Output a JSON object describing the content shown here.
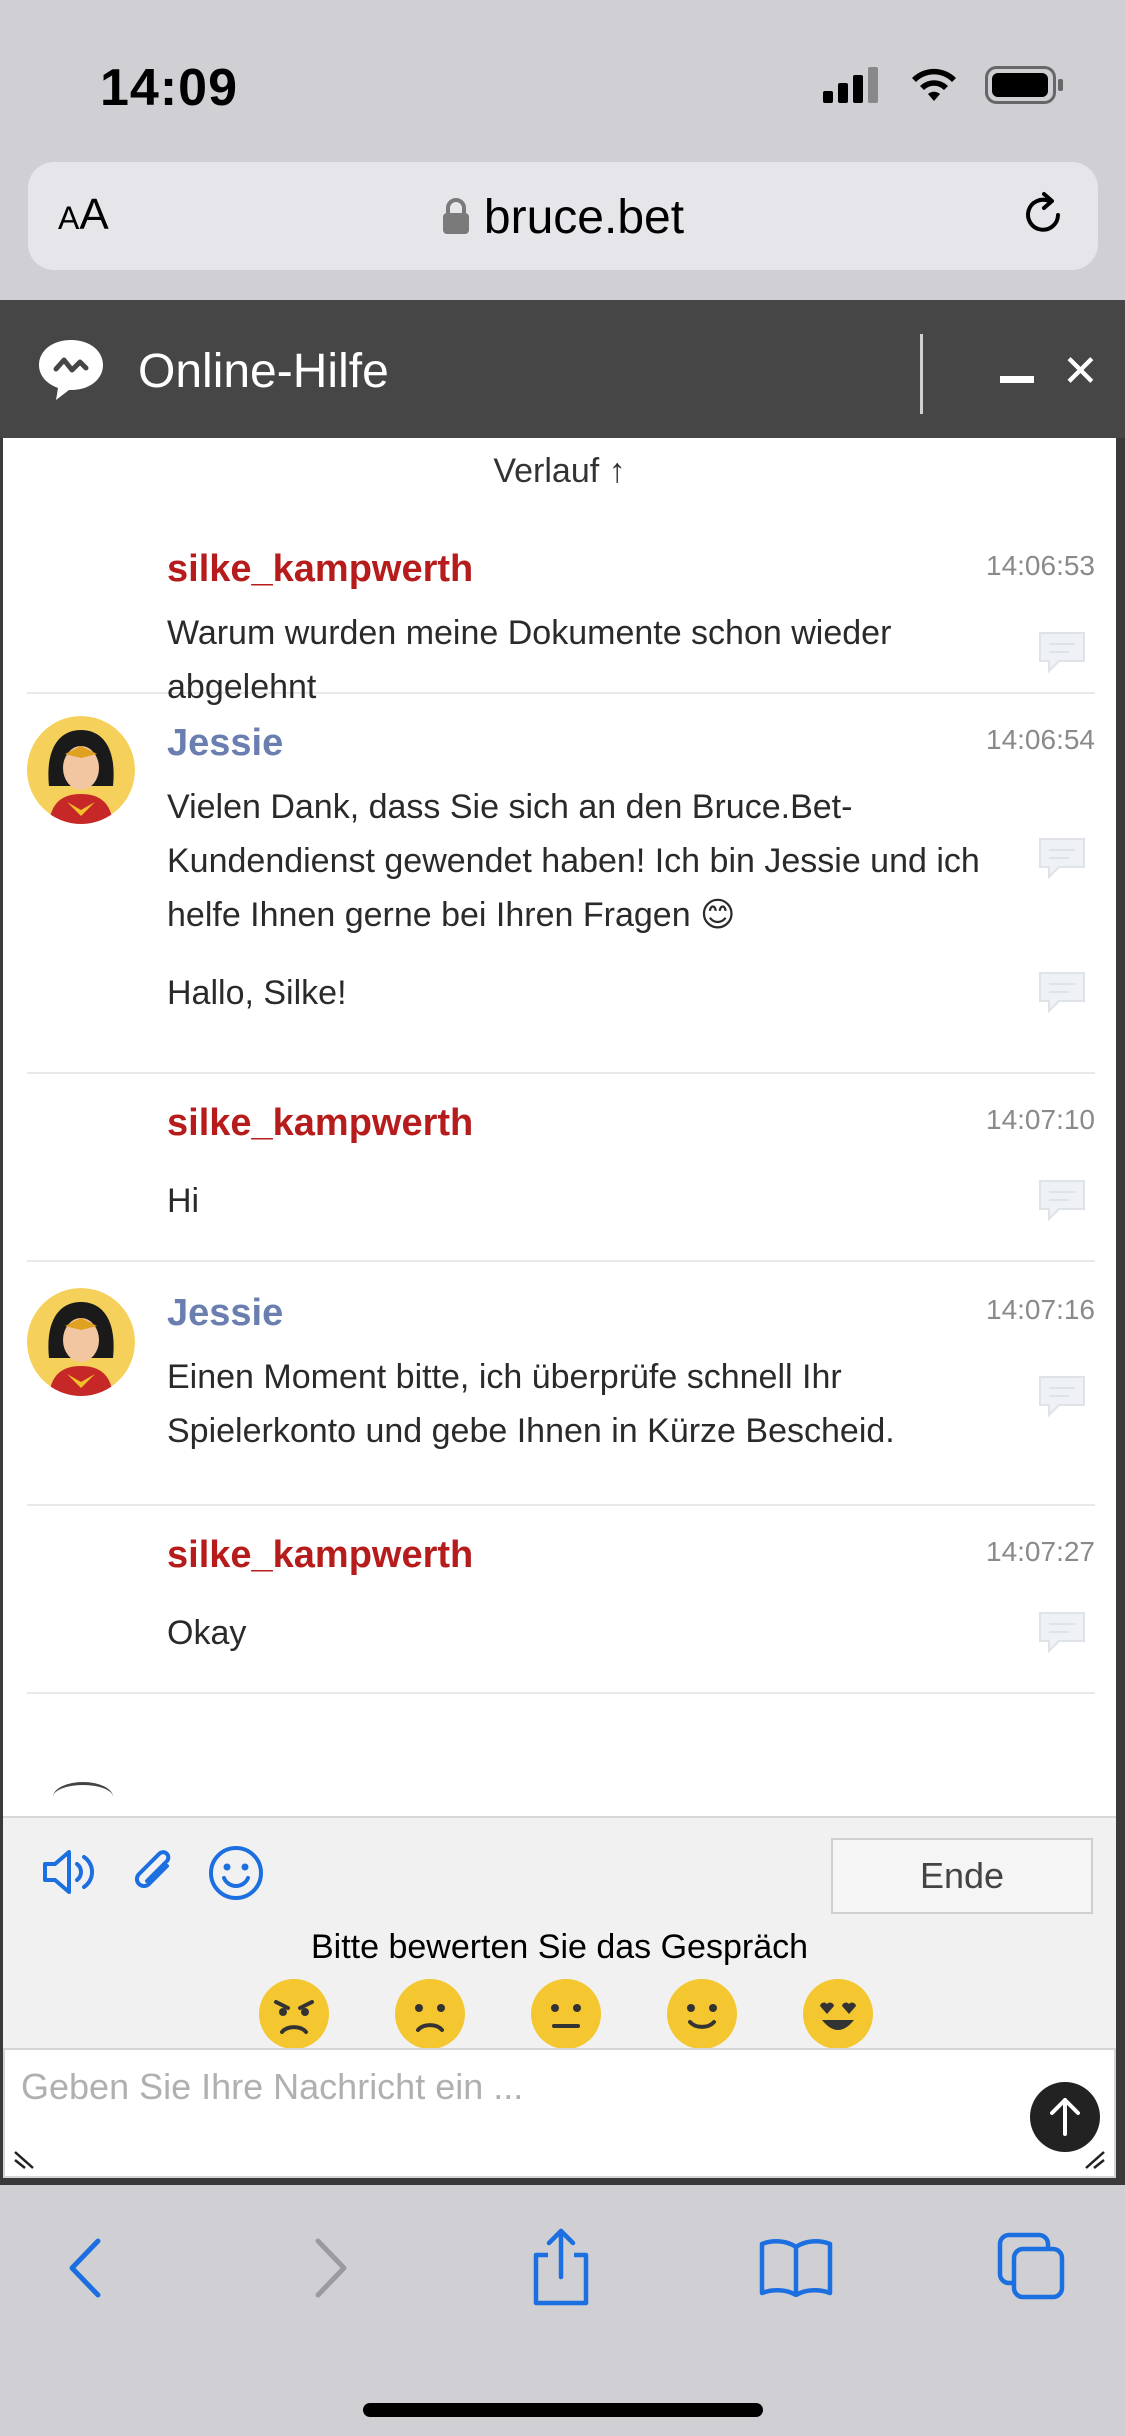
{
  "status_bar": {
    "time": "14:09"
  },
  "safari": {
    "text_size_label_small": "A",
    "text_size_label_large": "A",
    "url": "bruce.bet"
  },
  "widget": {
    "title": "Online-Hilfe",
    "history_label": "Verlauf ↑",
    "messages": [
      {
        "sender": "silke_kampwerth",
        "role": "user",
        "time": "14:06:53",
        "paragraphs": [
          "Warum wurden meine Dokumente schon wieder abgelehnt"
        ]
      },
      {
        "sender": "Jessie",
        "role": "agent",
        "time": "14:06:54",
        "paragraphs": [
          "Vielen Dank, dass Sie sich an den Bruce.Bet-Kundendienst gewendet haben! Ich bin Jessie und ich helfe Ihnen gerne bei Ihren Fragen 😊",
          "Hallo, Silke!"
        ]
      },
      {
        "sender": "silke_kampwerth",
        "role": "user",
        "time": "14:07:10",
        "paragraphs": [
          "Hi"
        ]
      },
      {
        "sender": "Jessie",
        "role": "agent",
        "time": "14:07:16",
        "paragraphs": [
          "Einen Moment bitte, ich überprüfe schnell Ihr Spielerkonto und gebe Ihnen in Kürze Bescheid."
        ]
      },
      {
        "sender": "silke_kampwerth",
        "role": "user",
        "time": "14:07:27",
        "paragraphs": [
          "Okay"
        ]
      }
    ],
    "toolbar": {
      "end_label": "Ende",
      "rating_prompt": "Bitte bewerten Sie das Gespräch"
    },
    "input": {
      "placeholder": "Geben Sie Ihre Nachricht ein ..."
    }
  },
  "colors": {
    "user_name": "#b71c1c",
    "agent_name": "#6a7fb0",
    "accent_blue": "#1c6fe0",
    "header_bg": "#464646"
  }
}
